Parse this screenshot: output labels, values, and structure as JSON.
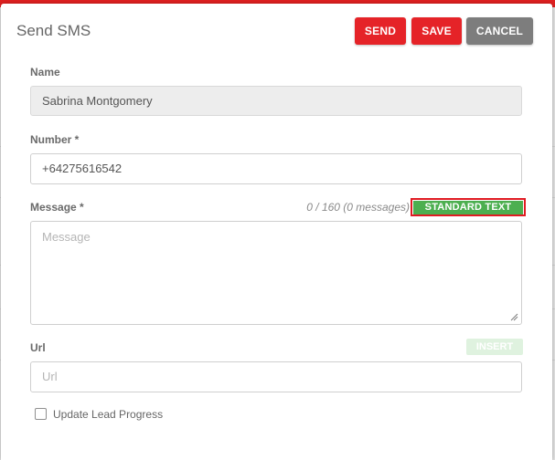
{
  "dialog": {
    "title": "Send SMS",
    "send_label": "SEND",
    "save_label": "SAVE",
    "cancel_label": "CANCEL"
  },
  "name": {
    "label": "Name",
    "value": "Sabrina Montgomery"
  },
  "number": {
    "label": "Number *",
    "value": "+64275616542"
  },
  "message": {
    "label": "Message *",
    "counter": "0 / 160 (0 messages)",
    "standard_text_label": "STANDARD TEXT",
    "placeholder": "Message",
    "value": ""
  },
  "url": {
    "label": "Url",
    "insert_label": "INSERT",
    "placeholder": "Url",
    "value": ""
  },
  "update_lead_progress": {
    "label": "Update Lead Progress",
    "checked": false
  },
  "colors": {
    "primary_red": "#e52328",
    "cancel_grey": "#7d7d7d",
    "standard_text_green": "#4caf50",
    "highlight_outline": "#e01b22"
  }
}
